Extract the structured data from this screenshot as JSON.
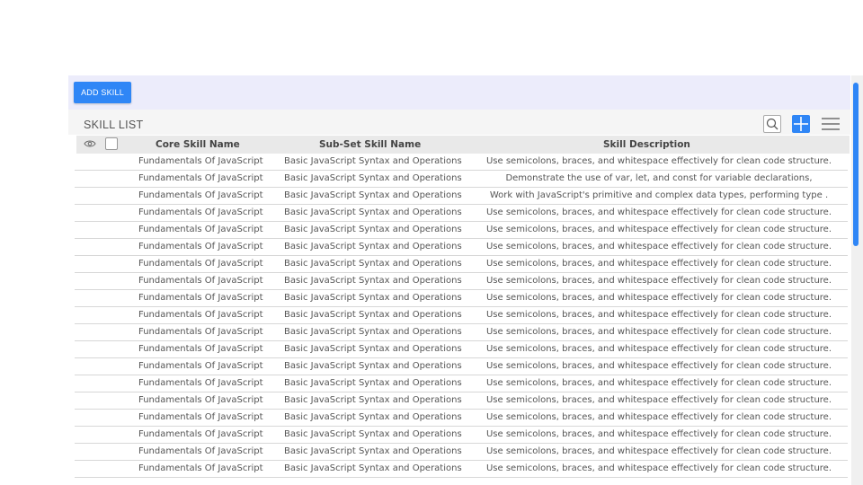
{
  "toolbar": {
    "add_label": "ADD SKILL"
  },
  "list": {
    "title": "SKILL LIST"
  },
  "columns": {
    "core": "Core Skill Name",
    "sub": "Sub-Set Skill Name",
    "desc": "Skill Description"
  },
  "rows": [
    {
      "core": "Fundamentals Of JavaScript",
      "sub": "Basic JavaScript Syntax and Operations",
      "desc": "Use semicolons, braces, and whitespace effectively for clean code structure."
    },
    {
      "core": "Fundamentals Of JavaScript",
      "sub": "Basic JavaScript Syntax and Operations",
      "desc": "Demonstrate the use of var, let, and const for variable declarations,"
    },
    {
      "core": "Fundamentals Of JavaScript",
      "sub": "Basic JavaScript Syntax and Operations",
      "desc": "Work with JavaScript's primitive and complex data types, performing type ."
    },
    {
      "core": "Fundamentals Of JavaScript",
      "sub": "Basic JavaScript Syntax and Operations",
      "desc": "Use semicolons, braces, and whitespace effectively for clean code structure."
    },
    {
      "core": "Fundamentals Of JavaScript",
      "sub": "Basic JavaScript Syntax and Operations",
      "desc": "Use semicolons, braces, and whitespace effectively for clean code structure."
    },
    {
      "core": "Fundamentals Of JavaScript",
      "sub": "Basic JavaScript Syntax and Operations",
      "desc": "Use semicolons, braces, and whitespace effectively for clean code structure."
    },
    {
      "core": "Fundamentals Of JavaScript",
      "sub": "Basic JavaScript Syntax and Operations",
      "desc": "Use semicolons, braces, and whitespace effectively for clean code structure."
    },
    {
      "core": "Fundamentals Of JavaScript",
      "sub": "Basic JavaScript Syntax and Operations",
      "desc": "Use semicolons, braces, and whitespace effectively for clean code structure."
    },
    {
      "core": "Fundamentals Of JavaScript",
      "sub": "Basic JavaScript Syntax and Operations",
      "desc": "Use semicolons, braces, and whitespace effectively for clean code structure."
    },
    {
      "core": "Fundamentals Of JavaScript",
      "sub": "Basic JavaScript Syntax and Operations",
      "desc": "Use semicolons, braces, and whitespace effectively for clean code structure."
    },
    {
      "core": "Fundamentals Of JavaScript",
      "sub": "Basic JavaScript Syntax and Operations",
      "desc": "Use semicolons, braces, and whitespace effectively for clean code structure."
    },
    {
      "core": "Fundamentals Of JavaScript",
      "sub": "Basic JavaScript Syntax and Operations",
      "desc": "Use semicolons, braces, and whitespace effectively for clean code structure."
    },
    {
      "core": "Fundamentals Of JavaScript",
      "sub": "Basic JavaScript Syntax and Operations",
      "desc": "Use semicolons, braces, and whitespace effectively for clean code structure."
    },
    {
      "core": "Fundamentals Of JavaScript",
      "sub": "Basic JavaScript Syntax and Operations",
      "desc": "Use semicolons, braces, and whitespace effectively for clean code structure."
    },
    {
      "core": "Fundamentals Of JavaScript",
      "sub": "Basic JavaScript Syntax and Operations",
      "desc": "Use semicolons, braces, and whitespace effectively for clean code structure."
    },
    {
      "core": "Fundamentals Of JavaScript",
      "sub": "Basic JavaScript Syntax and Operations",
      "desc": "Use semicolons, braces, and whitespace effectively for clean code structure."
    },
    {
      "core": "Fundamentals Of JavaScript",
      "sub": "Basic JavaScript Syntax and Operations",
      "desc": "Use semicolons, braces, and whitespace effectively for clean code structure."
    },
    {
      "core": "Fundamentals Of JavaScript",
      "sub": "Basic JavaScript Syntax and Operations",
      "desc": "Use semicolons, braces, and whitespace effectively for clean code structure."
    },
    {
      "core": "Fundamentals Of JavaScript",
      "sub": "Basic JavaScript Syntax and Operations",
      "desc": "Use semicolons, braces, and whitespace effectively for clean code structure."
    }
  ],
  "icons": {
    "visibility": "eye-icon",
    "select_all": "checkbox-icon",
    "search": "search-icon",
    "add": "plus-icon",
    "menu": "hamburger-menu-icon"
  },
  "colors": {
    "accent": "#2f86f6",
    "action_bar_bg": "#ececfb",
    "header_bg": "#e9e9e9"
  }
}
